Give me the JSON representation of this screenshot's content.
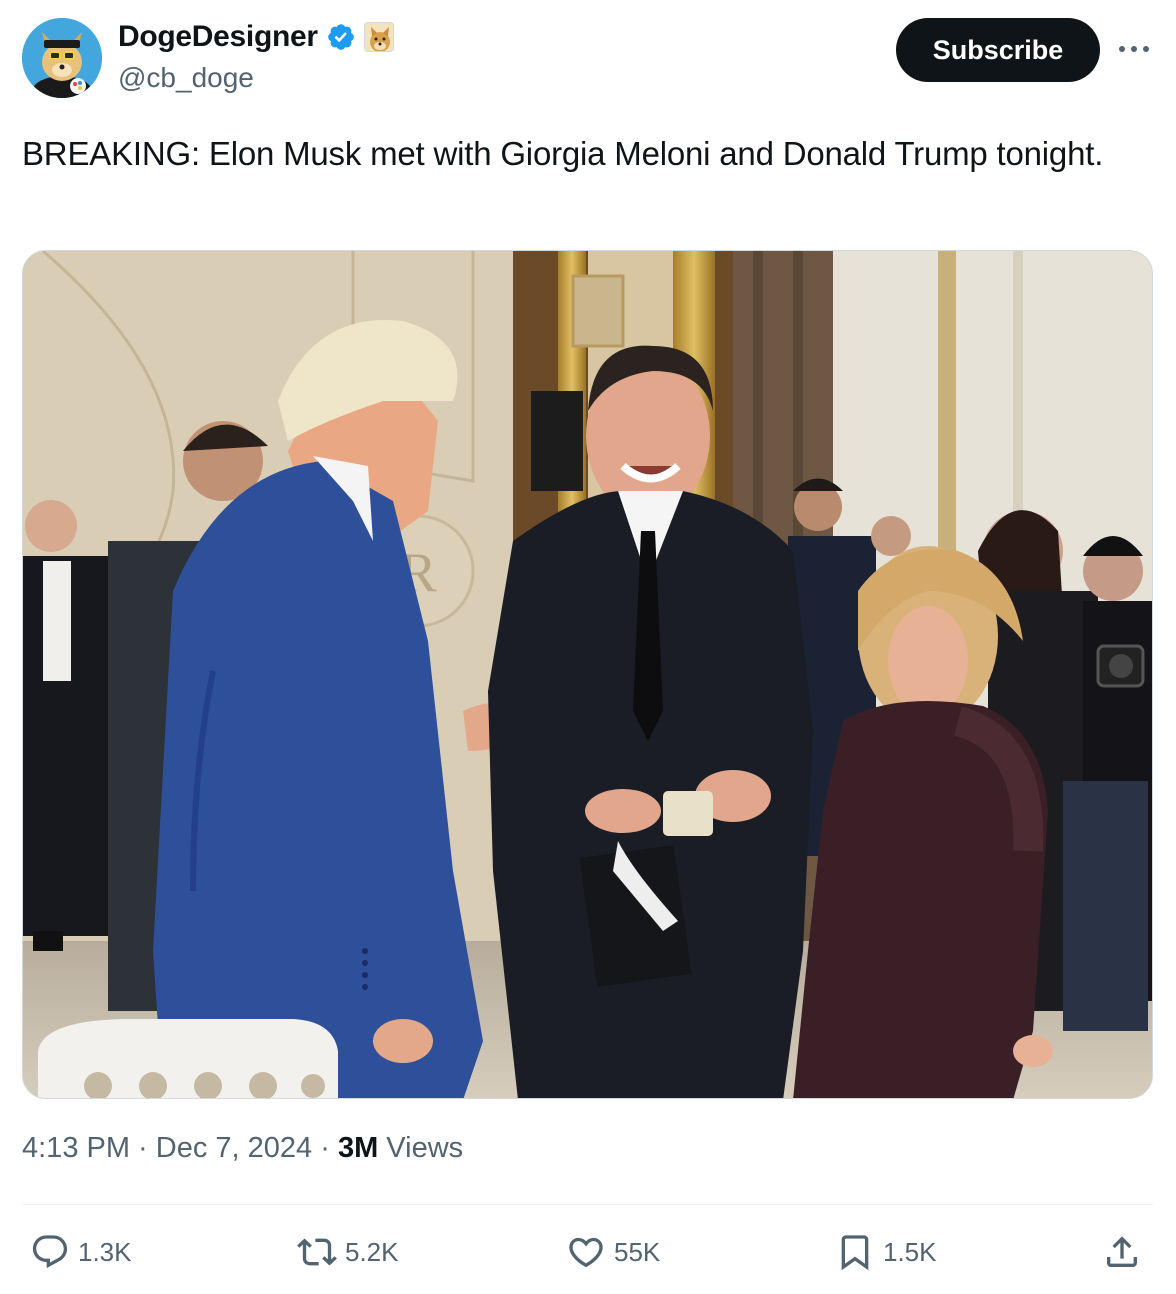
{
  "author": {
    "display_name": "DogeDesigner",
    "handle": "@cb_doge",
    "avatar_icon": "doge-avatar-icon",
    "verified_icon": "verified-badge-icon",
    "affiliate_icon": "doge-affiliate-badge-icon",
    "verified_color": "#1d9bf0"
  },
  "header": {
    "subscribe_label": "Subscribe",
    "more_icon": "more-icon"
  },
  "tweet": {
    "text": "BREAKING: Elon Musk met with Giorgia Meloni and Donald Trump tonight."
  },
  "meta": {
    "time": "4:13 PM",
    "sep1": " · ",
    "date": "Dec 7, 2024",
    "sep2": " · ",
    "views_count": "3M",
    "views_label": " Views"
  },
  "actions": {
    "reply": {
      "icon": "reply-icon",
      "count": "1.3K"
    },
    "repost": {
      "icon": "repost-icon",
      "count": "5.2K"
    },
    "like": {
      "icon": "heart-icon",
      "count": "55K"
    },
    "bookmark": {
      "icon": "bookmark-icon",
      "count": "1.5K"
    },
    "share": {
      "icon": "share-icon"
    }
  }
}
